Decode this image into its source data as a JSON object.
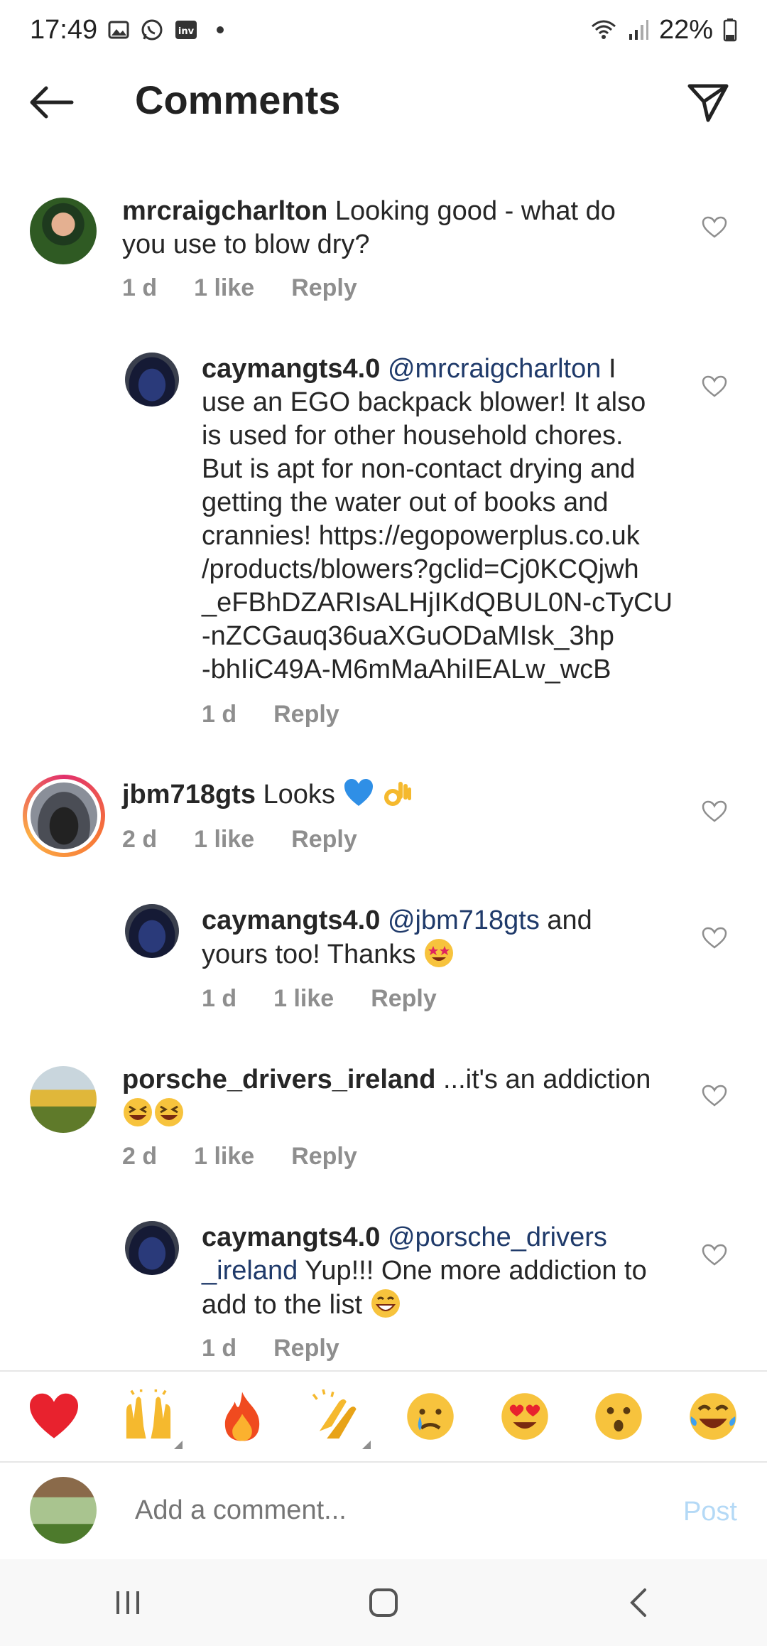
{
  "status_bar": {
    "time": "17:49",
    "battery": "22%"
  },
  "header": {
    "title": "Comments"
  },
  "comments": [
    {
      "username": "mrcraigcharlton",
      "text_line1": "Looking good - what do",
      "text_line2": "you use to blow  dry?",
      "age": "1 d",
      "likes": "1 like",
      "reply": "Reply"
    },
    {
      "username": "caymangts4.0",
      "mention": "@mrcraigcharlton",
      "lines": [
        "I",
        "use an EGO backpack blower! It also",
        "is used for other household chores.",
        "But is apt for non-contact drying and",
        "getting the water out of books and",
        "crannies! https://egopowerplus.co.uk",
        "/products/blowers?gclid=Cj0KCQjwh",
        "_eFBhDZARIsALHjIKdQBUL0N-cTyCU",
        "-nZCGauq36uaXGuODaMIsk_3hp",
        "-bhIiC49A-M6mMaAhiIEALw_wcB"
      ],
      "age": "1 d",
      "reply": "Reply"
    },
    {
      "username": "jbm718gts",
      "text": "Looks",
      "age": "2 d",
      "likes": "1 like",
      "reply": "Reply"
    },
    {
      "username": "caymangts4.0",
      "mention": "@jbm718gts",
      "text_line1": "and",
      "text_line2": "yours too! Thanks",
      "age": "1 d",
      "likes": "1 like",
      "reply": "Reply"
    },
    {
      "username": "porsche_drivers_ireland",
      "text": "...it's an addiction",
      "age": "2 d",
      "likes": "1 like",
      "reply": "Reply"
    },
    {
      "username": "caymangts4.0",
      "mention_line1": "@porsche_drivers",
      "mention_line2": "_ireland",
      "text_line2": "Yup!!! One more addiction to",
      "text_line3": "add to the list",
      "age": "1 d",
      "reply": "Reply"
    }
  ],
  "emoji_bar": [
    "red-heart",
    "raising-hands",
    "fire",
    "clapping-hands",
    "crying-face",
    "heart-eyes",
    "surprised-face",
    "tears-of-joy"
  ],
  "add_comment": {
    "placeholder": "Add a comment...",
    "post_label": "Post"
  },
  "colors": {
    "mention": "#1f3a6a",
    "meta": "#8e8e8e",
    "post": "#b4d9f6",
    "story_ring": "#e1306c"
  }
}
